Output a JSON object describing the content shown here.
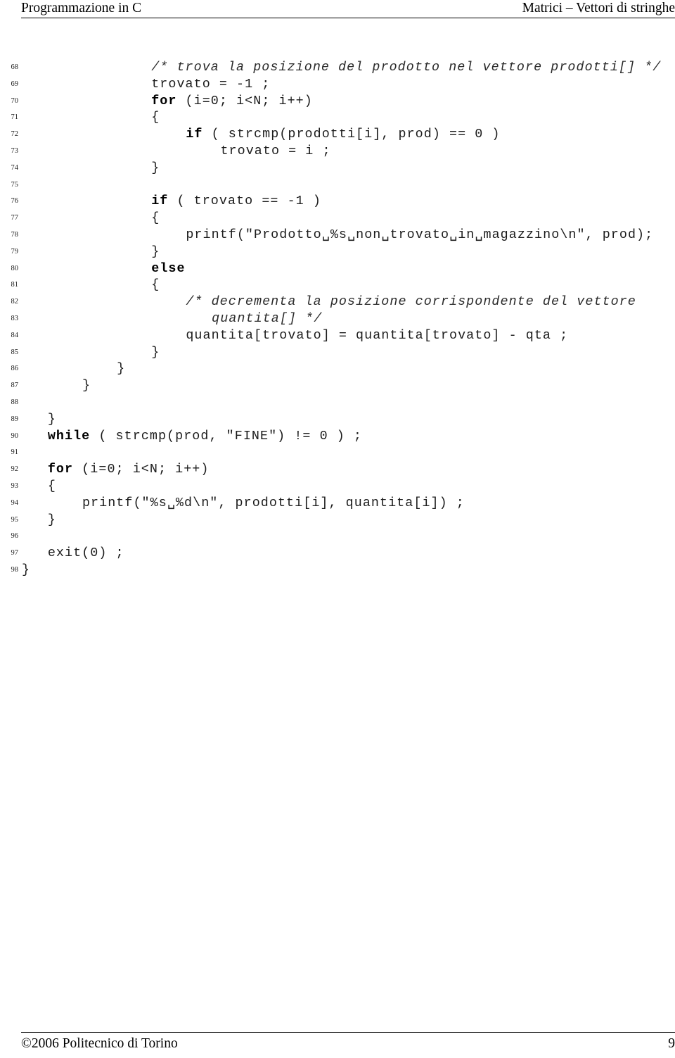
{
  "header": {
    "left": "Programmazione in C",
    "right": "Matrici – Vettori di stringhe"
  },
  "footer": {
    "left": "©2006 Politecnico di Torino",
    "right": "9"
  },
  "listing": {
    "first_line_number": 68,
    "lines": [
      {
        "num": "68",
        "indent": 15,
        "text": "/* trova la posizione del prodotto nel vettore prodotti[] */",
        "style": "comment"
      },
      {
        "num": "69",
        "indent": 15,
        "text": "trovato = -1 ;",
        "style": "plain"
      },
      {
        "num": "70",
        "indent": 15,
        "text": "for (i=0; i<N; i++)",
        "style": "keyword-first",
        "keyword": "for"
      },
      {
        "num": "71",
        "indent": 15,
        "text": "{",
        "style": "plain"
      },
      {
        "num": "72",
        "indent": 19,
        "text": "if ( strcmp(prodotti[i], prod) == 0 )",
        "style": "keyword-first",
        "keyword": "if"
      },
      {
        "num": "73",
        "indent": 23,
        "text": "trovato = i ;",
        "style": "plain"
      },
      {
        "num": "74",
        "indent": 15,
        "text": "}",
        "style": "plain"
      },
      {
        "num": "75",
        "indent": 0,
        "text": "",
        "style": "plain"
      },
      {
        "num": "76",
        "indent": 15,
        "text": "if ( trovato == -1 )",
        "style": "keyword-first",
        "keyword": "if"
      },
      {
        "num": "77",
        "indent": 15,
        "text": "{",
        "style": "plain"
      },
      {
        "num": "78",
        "indent": 19,
        "text": "printf(\"Prodotto %s non trovato in magazzino\\n\", prod);",
        "style": "plain"
      },
      {
        "num": "79",
        "indent": 15,
        "text": "}",
        "style": "plain"
      },
      {
        "num": "80",
        "indent": 15,
        "text": "else",
        "style": "keyword-only",
        "keyword": "else"
      },
      {
        "num": "81",
        "indent": 15,
        "text": "{",
        "style": "plain"
      },
      {
        "num": "82",
        "indent": 19,
        "text": "/* decrementa la posizione corrispondente del vettore",
        "style": "comment"
      },
      {
        "num": "83",
        "indent": 22,
        "text": "quantita[] */",
        "style": "comment"
      },
      {
        "num": "84",
        "indent": 19,
        "text": "quantita[trovato] = quantita[trovato] - qta ;",
        "style": "plain"
      },
      {
        "num": "85",
        "indent": 15,
        "text": "}",
        "style": "plain"
      },
      {
        "num": "86",
        "indent": 11,
        "text": "}",
        "style": "plain"
      },
      {
        "num": "87",
        "indent": 7,
        "text": "}",
        "style": "plain"
      },
      {
        "num": "88",
        "indent": 0,
        "text": "",
        "style": "plain"
      },
      {
        "num": "89",
        "indent": 3,
        "text": "}",
        "style": "plain"
      },
      {
        "num": "90",
        "indent": 3,
        "text": "while ( strcmp(prod, \"FINE\") != 0 ) ;",
        "style": "keyword-first",
        "keyword": "while"
      },
      {
        "num": "91",
        "indent": 0,
        "text": "",
        "style": "plain"
      },
      {
        "num": "92",
        "indent": 3,
        "text": "for (i=0; i<N; i++)",
        "style": "keyword-first",
        "keyword": "for"
      },
      {
        "num": "93",
        "indent": 3,
        "text": "{",
        "style": "plain"
      },
      {
        "num": "94",
        "indent": 7,
        "text": "printf(\"%s %d\\n\", prodotti[i], quantita[i]) ;",
        "style": "plain"
      },
      {
        "num": "95",
        "indent": 3,
        "text": "}",
        "style": "plain"
      },
      {
        "num": "96",
        "indent": 0,
        "text": "",
        "style": "plain"
      },
      {
        "num": "97",
        "indent": 3,
        "text": "exit(0) ;",
        "style": "plain"
      },
      {
        "num": "98",
        "indent": 0,
        "text": "}",
        "style": "plain"
      }
    ]
  },
  "colors": {
    "text": "#000000",
    "code": "#1c1c1c",
    "rule": "#000000",
    "background": "#ffffff"
  }
}
